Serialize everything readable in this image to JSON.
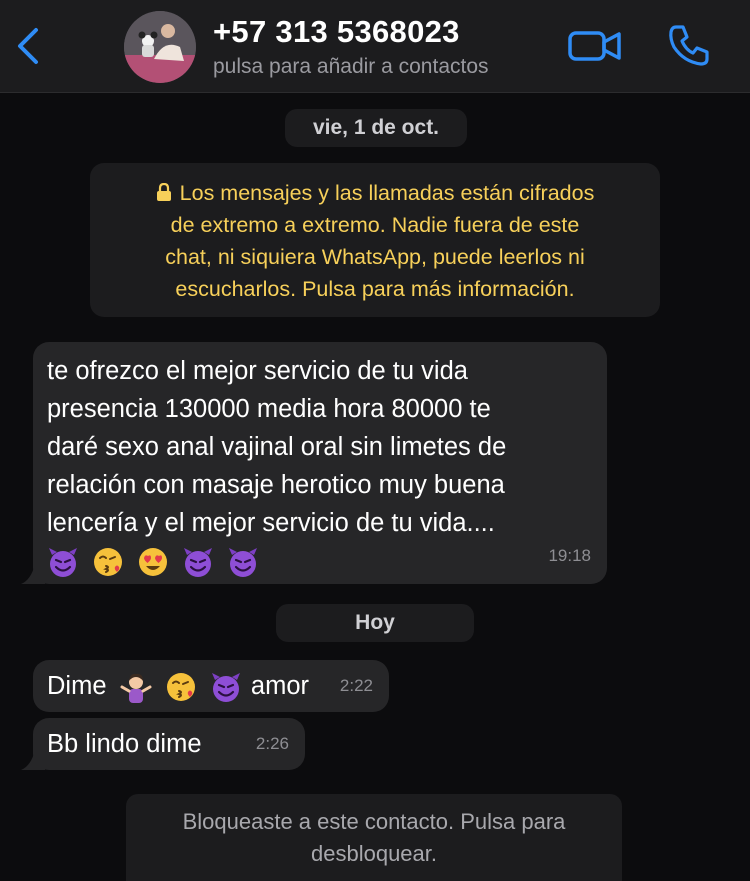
{
  "header": {
    "contact_name": "+57 313 5368023",
    "contact_subtitle": "pulsa para añadir a contactos",
    "back_icon": "chevron-left-icon",
    "video_icon": "video-camera-icon",
    "call_icon": "phone-icon",
    "accent_color": "#2f8cf5"
  },
  "chat": {
    "date_separator_1": "vie, 1 de oct.",
    "encryption_notice": {
      "lines": [
        "Los mensajes y las llamadas están cifrados",
        "de extremo a extremo. Nadie fuera de este",
        "chat, ni siquiera WhatsApp, puede leerlos ni",
        "escucharlos. Pulsa para más información."
      ],
      "color": "#f7d05a"
    },
    "messages": [
      {
        "lines": [
          "te ofrezco  el mejor servicio de tu vida",
          "presencia 130000 media hora 80000  te",
          "daré sexo anal vajinal  oral sin limetes de",
          "relación   con masaje herotico muy buena",
          "lencería   y el mejor servicio de tu vida...."
        ],
        "emojis": [
          "smiling-devil-icon",
          "kiss-face-icon",
          "heart-eyes-icon",
          "smiling-devil-icon",
          "smiling-devil-icon"
        ],
        "time": "19:18"
      },
      {
        "text_before": "Dime",
        "emojis": [
          "shrug-woman-icon",
          "kiss-face-icon",
          "smiling-devil-icon"
        ],
        "text_after": "amor",
        "time": "2:22"
      },
      {
        "text": "Bb lindo dime",
        "time": "2:26"
      }
    ],
    "date_separator_2": "Hoy",
    "block_notice": {
      "lines": [
        "Bloqueaste a este contacto. Pulsa para",
        "desbloquear."
      ]
    }
  }
}
